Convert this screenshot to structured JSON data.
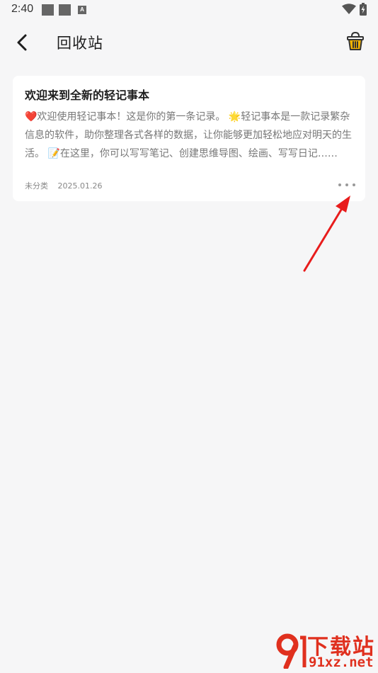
{
  "status_bar": {
    "time": "2:40",
    "notification_badge": "A"
  },
  "header": {
    "title": "回收站"
  },
  "note_card": {
    "title": "欢迎来到全新的轻记事本",
    "preview": "❤️欢迎使用轻记事本！这是你的第一条记录。 🌟轻记事本是一款记录繁杂信息的软件，助你整理各式各样的数据，让你能够更加轻松地应对明天的生活。 📝在这里，你可以写写笔记、创建思维导图、绘画、写写日记……",
    "category": "未分类",
    "date": "2025.01.26"
  },
  "watermark": {
    "line1": "下载站",
    "line2": "91xz.net"
  },
  "colors": {
    "background": "#f6f6f7",
    "card": "#ffffff",
    "trash_accent": "#f5b400",
    "annotation_arrow": "#e81c1c",
    "watermark": "#e0301e"
  }
}
